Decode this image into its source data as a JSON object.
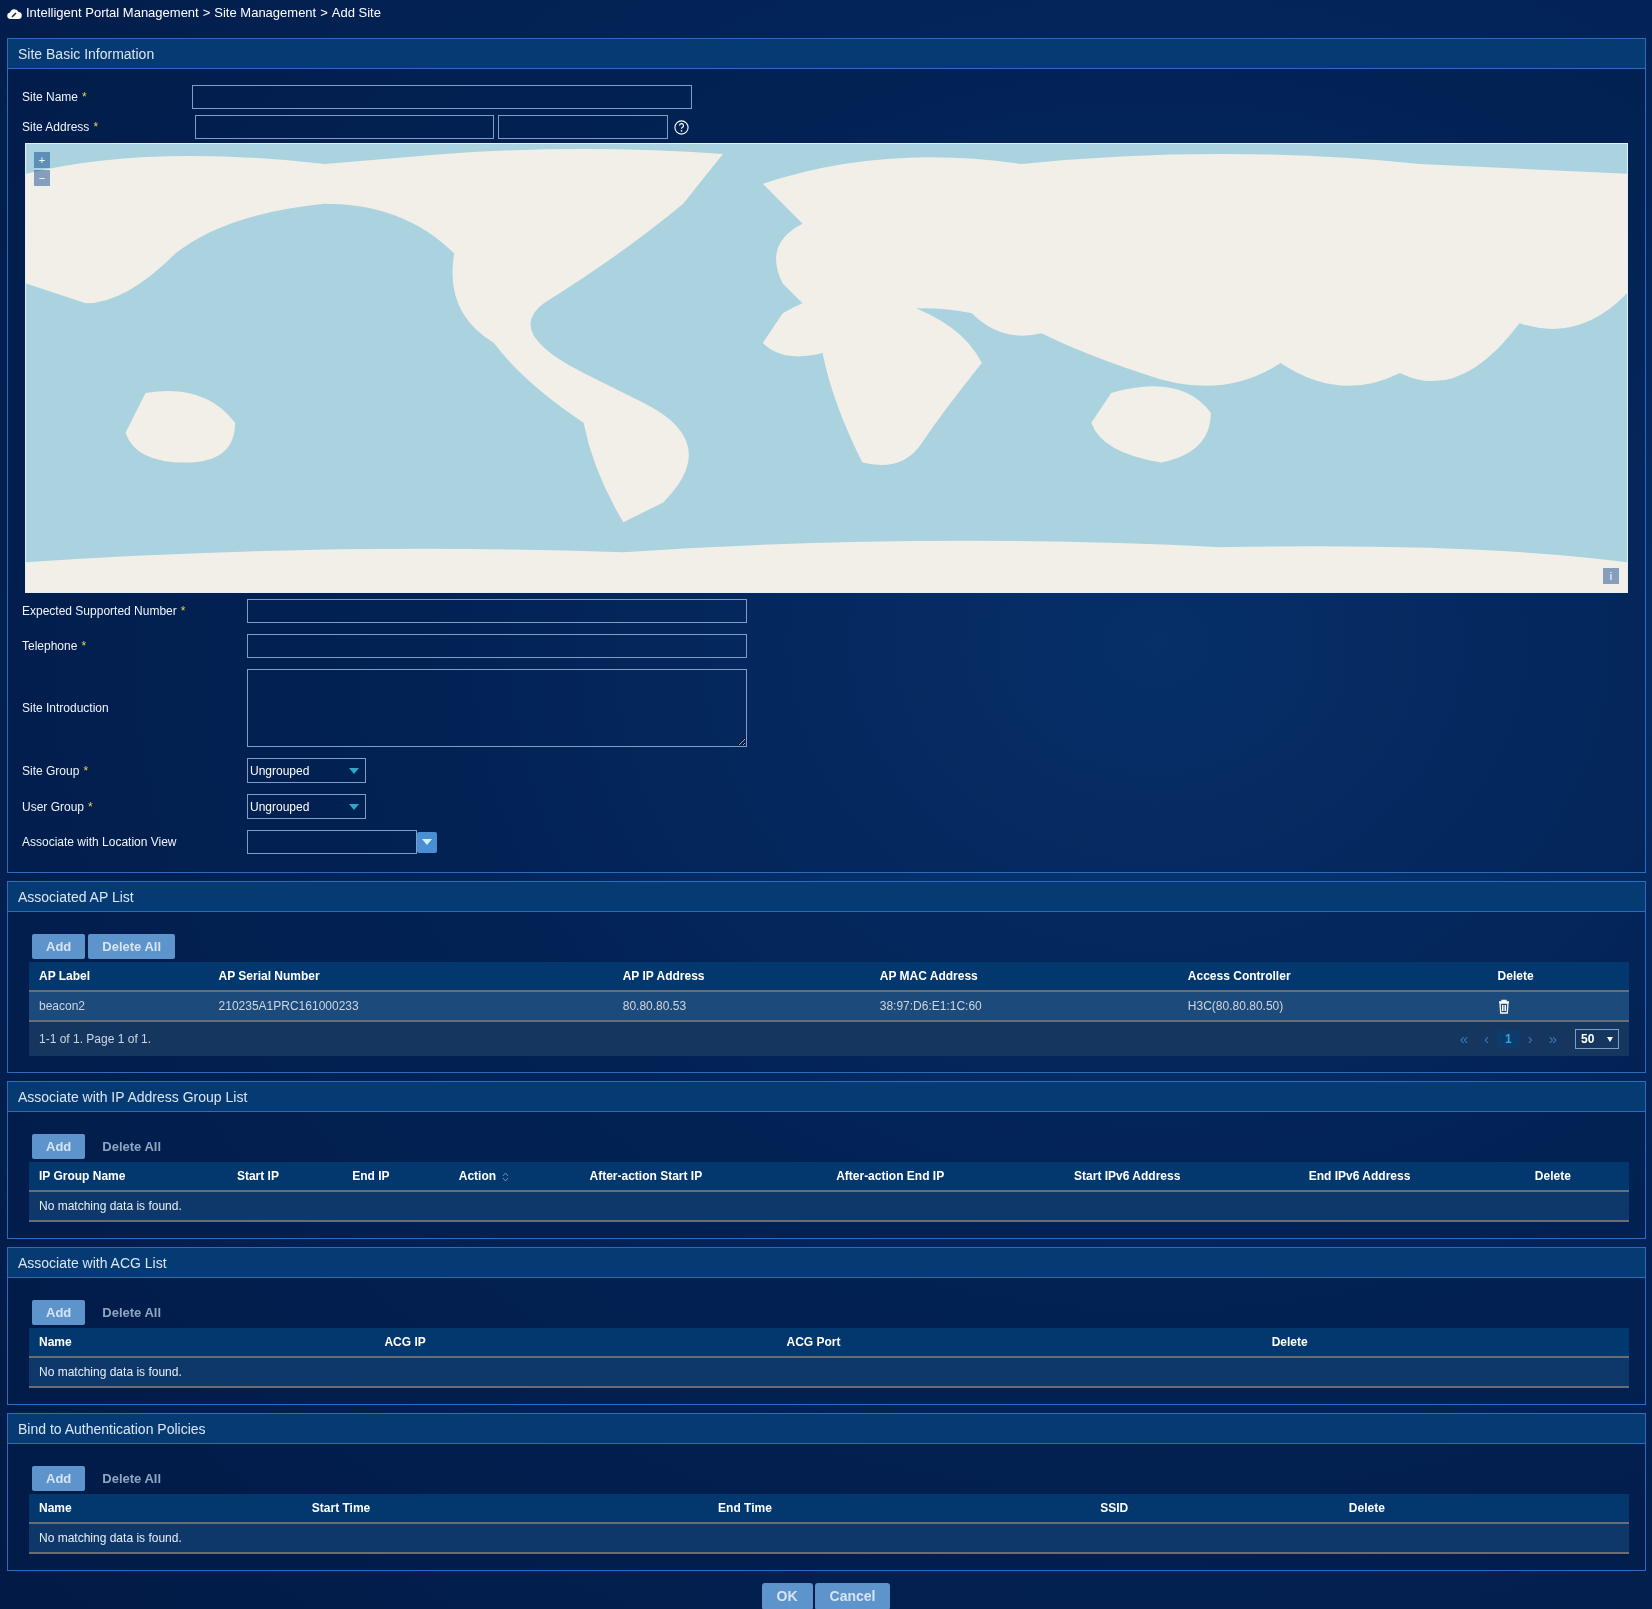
{
  "breadcrumb": {
    "separator": ">",
    "items": [
      "Intelligent Portal Management",
      "Site Management",
      "Add Site"
    ]
  },
  "basic_info": {
    "title": "Site Basic Information",
    "fields_top": [
      {
        "kind": "text",
        "label": "Site Name",
        "required_mark": "*"
      },
      {
        "kind": "address",
        "label": "Site Address",
        "required_mark": "*"
      }
    ],
    "map": {
      "zoom_in": "+",
      "zoom_out": "−",
      "info": "i"
    },
    "fields": [
      {
        "kind": "text",
        "label": "Expected Supported Number",
        "required_mark": "*"
      },
      {
        "kind": "text",
        "label": "Telephone",
        "required_mark": "*"
      },
      {
        "kind": "textarea",
        "label": "Site Introduction"
      },
      {
        "kind": "select",
        "label": "Site Group",
        "required_mark": "*",
        "value": "Ungrouped"
      },
      {
        "kind": "select",
        "label": "User Group",
        "required_mark": "*",
        "value": "Ungrouped"
      },
      {
        "kind": "combo",
        "label": "Associate with Location View"
      }
    ]
  },
  "sections": [
    {
      "title": "Associated AP List",
      "buttons": [
        {
          "label": "Add",
          "disabled": false
        },
        {
          "label": "Delete All",
          "disabled": false
        }
      ],
      "columns": [
        {
          "label": "AP Label",
          "sortable": false
        },
        {
          "label": "AP Serial Number",
          "sortable": false
        },
        {
          "label": "AP IP Address",
          "sortable": false
        },
        {
          "label": "AP MAC Address",
          "sortable": false
        },
        {
          "label": "Access Controller",
          "sortable": false
        },
        {
          "label": "Delete",
          "sortable": false
        }
      ],
      "rows": [
        {
          "cells": [
            "beacon2",
            "210235A1PRC161000233",
            "80.80.80.53",
            "38:97:D6:E1:1C:60",
            "H3C(80.80.80.50)"
          ],
          "deletable": true
        }
      ],
      "pagination": {
        "summary": "1-1 of 1. Page 1 of 1.",
        "first": "«",
        "prev": "‹",
        "pages": [
          {
            "label": "1",
            "selected": true
          }
        ],
        "next": "›",
        "last": "»",
        "page_size": "50"
      }
    },
    {
      "title": "Associate with IP Address Group List",
      "buttons": [
        {
          "label": "Add",
          "disabled": false
        },
        {
          "label": "Delete All",
          "disabled": true
        }
      ],
      "columns": [
        {
          "label": "IP Group Name",
          "sortable": false
        },
        {
          "label": "Start IP",
          "sortable": false
        },
        {
          "label": "End IP",
          "sortable": false
        },
        {
          "label": "Action",
          "sortable": true
        },
        {
          "label": "After-action Start IP",
          "sortable": false
        },
        {
          "label": "After-action End IP",
          "sortable": false
        },
        {
          "label": "Start IPv6 Address",
          "sortable": false
        },
        {
          "label": "End IPv6 Address",
          "sortable": false
        },
        {
          "label": "Delete",
          "sortable": false
        }
      ],
      "empty_message": "No matching data is found."
    },
    {
      "title": "Associate with ACG List",
      "buttons": [
        {
          "label": "Add",
          "disabled": false
        },
        {
          "label": "Delete All",
          "disabled": true
        }
      ],
      "columns": [
        {
          "label": "Name",
          "sortable": false
        },
        {
          "label": "ACG IP",
          "sortable": false
        },
        {
          "label": "ACG Port",
          "sortable": false
        },
        {
          "label": "Delete",
          "sortable": false
        }
      ],
      "empty_message": "No matching data is found."
    },
    {
      "title": "Bind to Authentication Policies",
      "buttons": [
        {
          "label": "Add",
          "disabled": false
        },
        {
          "label": "Delete All",
          "disabled": true
        }
      ],
      "columns": [
        {
          "label": "Name",
          "sortable": false
        },
        {
          "label": "Start Time",
          "sortable": false
        },
        {
          "label": "End Time",
          "sortable": false
        },
        {
          "label": "SSID",
          "sortable": false
        },
        {
          "label": "Delete",
          "sortable": false
        }
      ],
      "empty_message": "No matching data is found."
    }
  ],
  "footer_buttons": [
    {
      "label": "OK"
    },
    {
      "label": "Cancel"
    }
  ]
}
